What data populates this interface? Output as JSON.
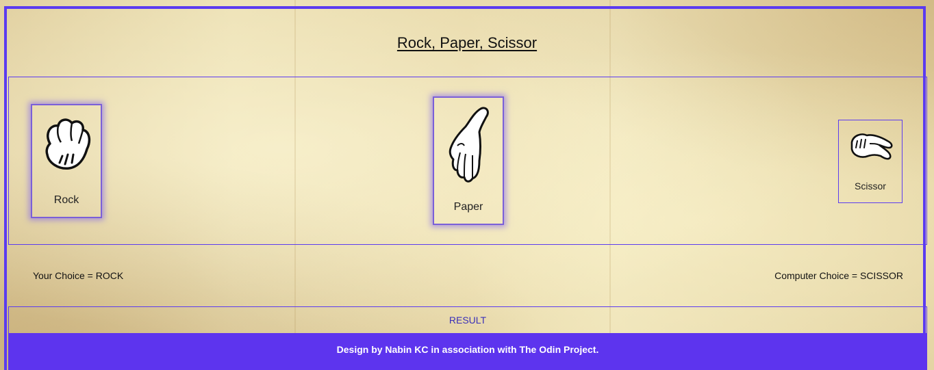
{
  "title": "Rock, Paper, Scissor",
  "choices": [
    {
      "label": "Rock",
      "icon": "rock-hand-icon"
    },
    {
      "label": "Paper",
      "icon": "paper-hand-icon"
    },
    {
      "label": "Scissor",
      "icon": "scissor-hand-icon"
    }
  ],
  "status": {
    "your_choice": "Your Choice = ROCK",
    "computer_choice": "Computer Choice = SCISSOR"
  },
  "result": "RESULT",
  "footer": "Design by Nabin KC in association with The Odin Project.",
  "colors": {
    "accent": "#5d34ee",
    "border": "#5b3bf0",
    "result_text": "#3a2fb8"
  }
}
